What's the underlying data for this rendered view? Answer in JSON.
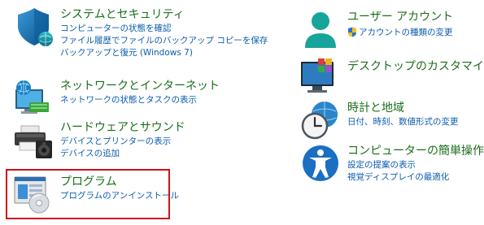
{
  "left": [
    {
      "name": "system-security",
      "title": "システムとセキュリティ",
      "links": [
        "コンピューターの状態を確認",
        "ファイル履歴でファイルのバックアップ コピーを保存",
        "バックアップと復元 (Windows 7)"
      ],
      "icon": "shield-icon"
    },
    {
      "name": "network-internet",
      "title": "ネットワークとインターネット",
      "links": [
        "ネットワークの状態とタスクの表示"
      ],
      "icon": "network-globe-icon"
    },
    {
      "name": "hardware-sound",
      "title": "ハードウェアとサウンド",
      "links": [
        "デバイスとプリンターの表示",
        "デバイスの追加"
      ],
      "icon": "printer-speaker-icon"
    },
    {
      "name": "programs",
      "title": "プログラム",
      "links": [
        "プログラムのアンインストール"
      ],
      "icon": "programs-disc-icon"
    }
  ],
  "right": [
    {
      "name": "user-accounts",
      "title": "ユーザー アカウント",
      "links": [
        "アカウントの種類の変更"
      ],
      "icon": "user-icon",
      "link_icon": "uac-shield-icon"
    },
    {
      "name": "appearance",
      "title": "デスクトップのカスタマイズ",
      "links": [],
      "icon": "monitor-palette-icon"
    },
    {
      "name": "clock-region",
      "title": "時計と地域",
      "links": [
        "日付、時刻、数値形式の変更"
      ],
      "icon": "clock-globe-icon"
    },
    {
      "name": "ease-of-access",
      "title": "コンピューターの簡単操作",
      "links": [
        "設定の提案の表示",
        "視覚ディスプレイの最適化"
      ],
      "icon": "accessibility-icon"
    }
  ],
  "colors": {
    "title": "#1a6e1a",
    "link": "#0b5cad",
    "highlight_border": "#d0101a"
  }
}
